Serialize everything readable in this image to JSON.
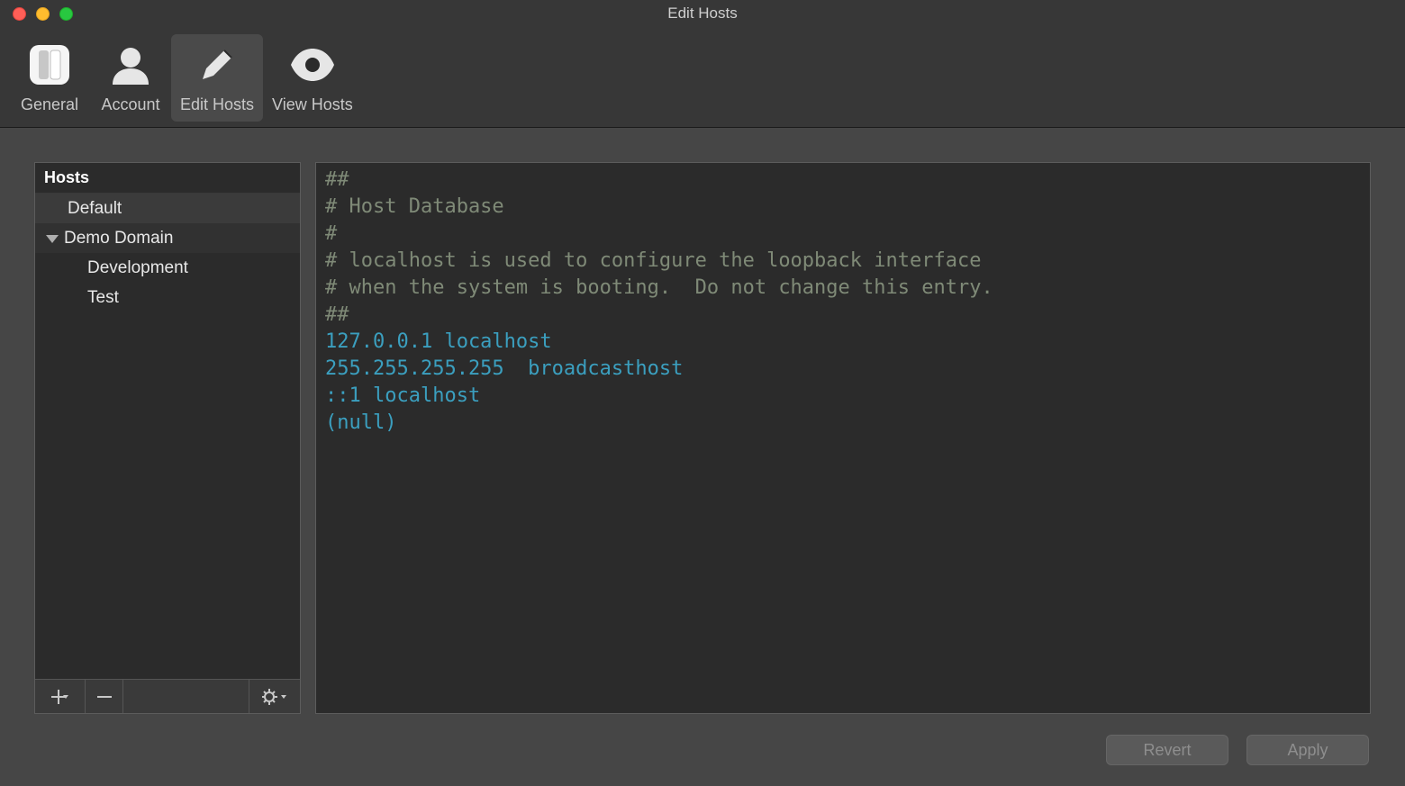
{
  "window": {
    "title": "Edit Hosts"
  },
  "toolbar": {
    "items": [
      {
        "id": "general",
        "label": "General",
        "icon": "switch-icon",
        "selected": false
      },
      {
        "id": "account",
        "label": "Account",
        "icon": "person-icon",
        "selected": false
      },
      {
        "id": "edit-hosts",
        "label": "Edit Hosts",
        "icon": "pencil-icon",
        "selected": true
      },
      {
        "id": "view-hosts",
        "label": "View Hosts",
        "icon": "eye-icon",
        "selected": false
      }
    ]
  },
  "sidebar": {
    "header": "Hosts",
    "tree": [
      {
        "label": "Default",
        "level": 0,
        "group": false
      },
      {
        "label": "Demo Domain",
        "level": 0,
        "group": true,
        "expanded": true
      },
      {
        "label": "Development",
        "level": 1,
        "group": false
      },
      {
        "label": "Test",
        "level": 1,
        "group": false
      }
    ]
  },
  "editor": {
    "lines": [
      {
        "text": "##",
        "cls": "c"
      },
      {
        "text": "# Host Database",
        "cls": "c"
      },
      {
        "text": "#",
        "cls": "c"
      },
      {
        "text": "# localhost is used to configure the loopback interface",
        "cls": "c"
      },
      {
        "text": "# when the system is booting.  Do not change this entry.",
        "cls": "c"
      },
      {
        "text": "##",
        "cls": "c"
      },
      {
        "text": "127.0.0.1 localhost",
        "cls": "k"
      },
      {
        "text": "255.255.255.255  broadcasthost",
        "cls": "k"
      },
      {
        "text": "::1 localhost",
        "cls": "k"
      },
      {
        "text": "(null)",
        "cls": "k"
      }
    ]
  },
  "buttons": {
    "revert": "Revert",
    "apply": "Apply"
  },
  "colors": {
    "comment": "#7f8a77",
    "entry": "#3b9fbf"
  }
}
